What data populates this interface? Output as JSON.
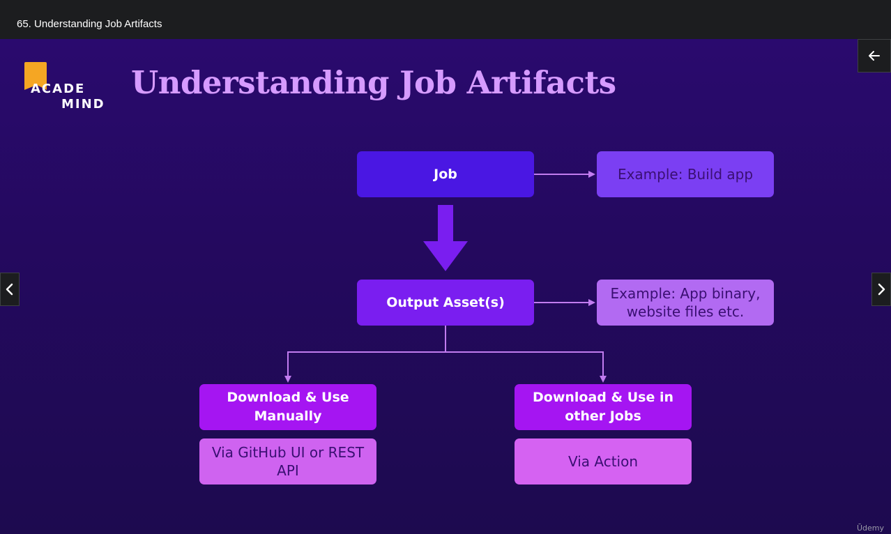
{
  "header": {
    "lecture_title": "65. Understanding Job Artifacts"
  },
  "slide": {
    "logo": {
      "line1": "ACADE",
      "line2": "MIND"
    },
    "title": "Understanding Job Artifacts",
    "boxes": {
      "job": "Job",
      "example_build": "Example: Build app",
      "output": "Output Asset(s)",
      "example_binary": "Example: App binary, website files etc.",
      "download_manual": "Download & Use Manually",
      "download_jobs": "Download & Use in other Jobs",
      "via_github": "Via GitHub UI or REST API",
      "via_action": "Via Action"
    },
    "watermark": "Ūdemy"
  },
  "nav": {
    "back_icon": "arrow-left-icon",
    "prev_icon": "chevron-left-icon",
    "next_icon": "chevron-right-icon"
  },
  "colors": {
    "title": "#d69bff",
    "job": "#4a17e3",
    "output": "#7a1ef0",
    "download": "#a515f2",
    "via": "#cf63f0",
    "connector": "#c27cf0"
  }
}
